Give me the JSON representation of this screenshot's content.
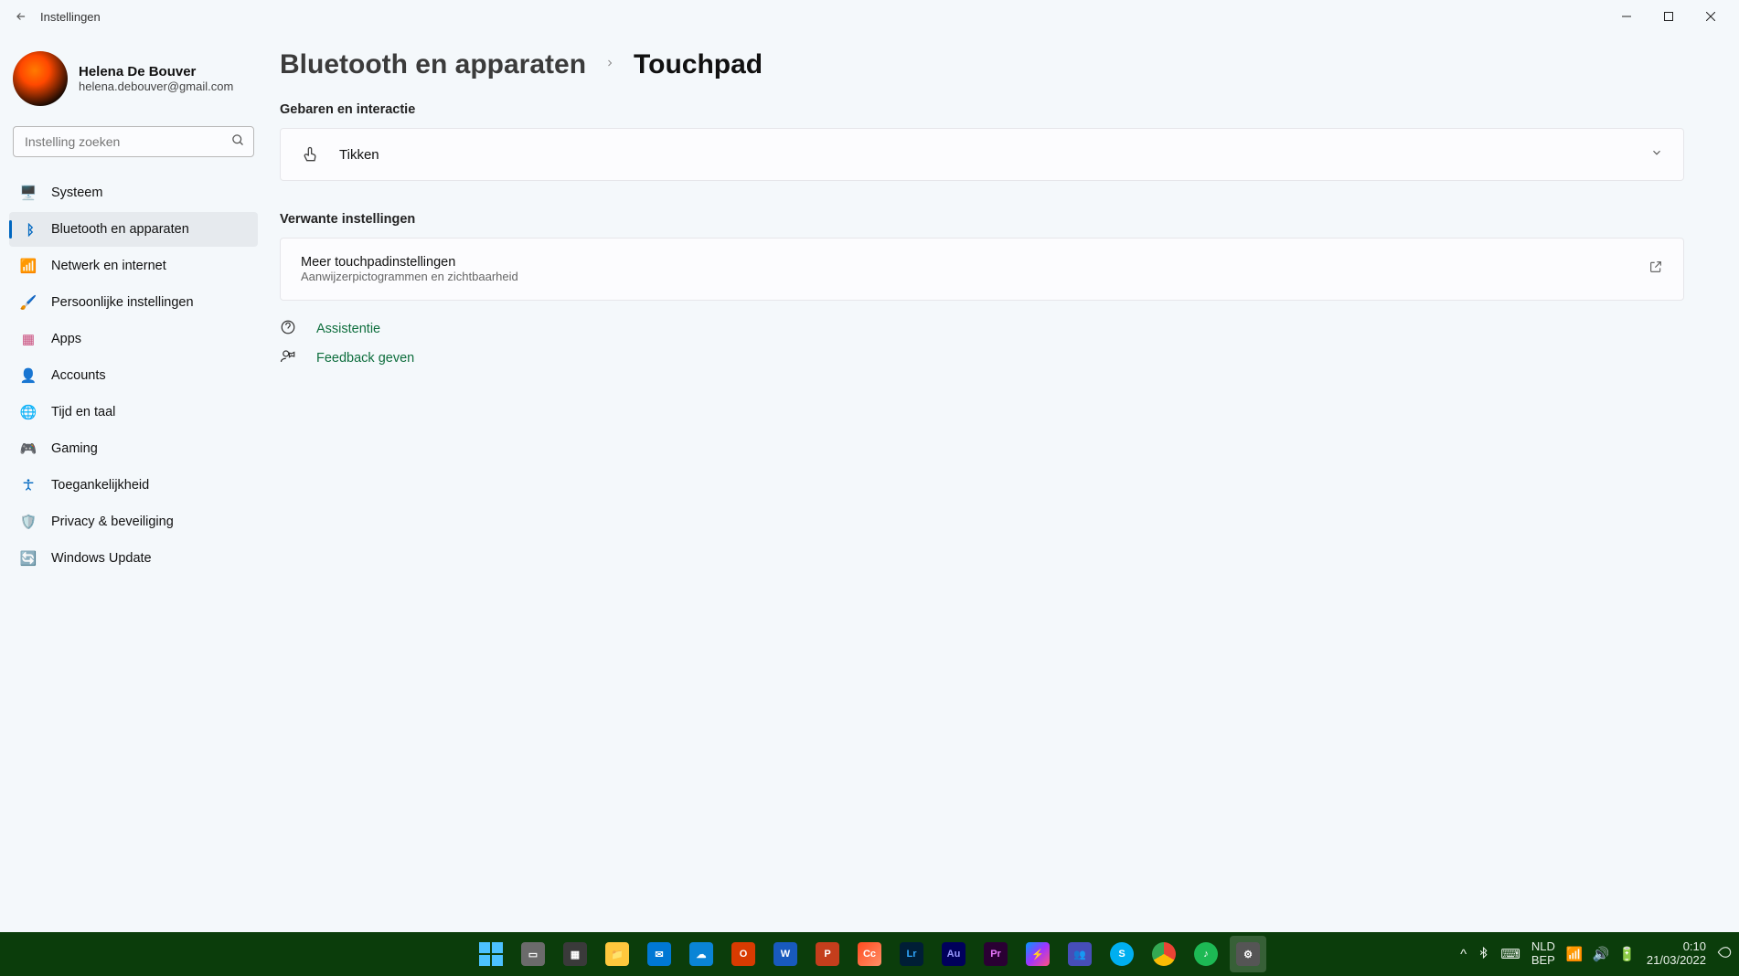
{
  "window": {
    "title": "Instellingen"
  },
  "profile": {
    "name": "Helena De Bouver",
    "email": "helena.debouver@gmail.com"
  },
  "search": {
    "placeholder": "Instelling zoeken"
  },
  "nav": {
    "system": "Systeem",
    "bluetooth": "Bluetooth en apparaten",
    "network": "Netwerk en internet",
    "personalization": "Persoonlijke instellingen",
    "apps": "Apps",
    "accounts": "Accounts",
    "time": "Tijd en taal",
    "gaming": "Gaming",
    "accessibility": "Toegankelijkheid",
    "privacy": "Privacy & beveiliging",
    "update": "Windows Update"
  },
  "breadcrumb": {
    "parent": "Bluetooth en apparaten",
    "current": "Touchpad"
  },
  "sections": {
    "gestures": "Gebaren en interactie",
    "related": "Verwante instellingen"
  },
  "cards": {
    "taps": "Tikken",
    "more_touchpad_title": "Meer touchpadinstellingen",
    "more_touchpad_sub": "Aanwijzerpictogrammen en zichtbaarheid"
  },
  "links": {
    "help": "Assistentie",
    "feedback": "Feedback geven"
  },
  "tray": {
    "lang1": "NLD",
    "lang2": "BEP",
    "time": "0:10",
    "date": "21/03/2022"
  }
}
